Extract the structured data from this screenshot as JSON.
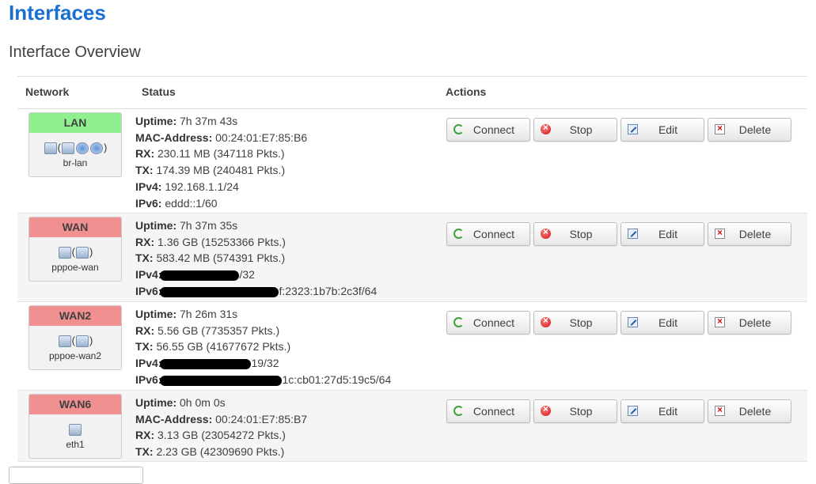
{
  "page": {
    "title": "Interfaces",
    "section": "Interface Overview"
  },
  "table": {
    "headers": {
      "network": "Network",
      "status": "Status",
      "actions": "Actions"
    },
    "actions": {
      "connect": "Connect",
      "stop": "Stop",
      "edit": "Edit",
      "delete": "Delete"
    },
    "rows": [
      {
        "name": "LAN",
        "color": "#90f090",
        "device": "br-lan",
        "icons": [
          "ethernet-icon",
          "bridge-icon",
          "wifi-icon",
          "wifi-icon"
        ],
        "status": [
          {
            "k": "Uptime:",
            "v": " 7h 37m 43s"
          },
          {
            "k": "MAC-Address:",
            "v": " 00:24:01:E7:85:B6"
          },
          {
            "k": "RX:",
            "v": " 230.11 MB (347118 Pkts.)"
          },
          {
            "k": "TX:",
            "v": " 174.39 MB (240481 Pkts.)"
          },
          {
            "k": "IPv4:",
            "v": " 192.168.1.1/24"
          },
          {
            "k": "IPv6:",
            "v": " eddd::1/60"
          }
        ]
      },
      {
        "name": "WAN",
        "color": "#f09090",
        "device": "pppoe-wan",
        "icons": [
          "network-icon",
          "ethernet-icon"
        ],
        "status": [
          {
            "k": "Uptime:",
            "v": " 7h 37m 35s"
          },
          {
            "k": "RX:",
            "v": " 1.36 GB (15253366 Pkts.)"
          },
          {
            "k": "TX:",
            "v": " 583.42 MB (574391 Pkts.)"
          },
          {
            "k": "IPv4:",
            "v": "/32"
          },
          {
            "k": "IPv6:",
            "v": "f:2323:1b7b:2c3f/64"
          }
        ]
      },
      {
        "name": "WAN2",
        "color": "#f09090",
        "device": "pppoe-wan2",
        "icons": [
          "network-icon",
          "ethernet-icon"
        ],
        "status": [
          {
            "k": "Uptime:",
            "v": " 7h 26m 31s"
          },
          {
            "k": "RX:",
            "v": " 5.56 GB (7735357 Pkts.)"
          },
          {
            "k": "TX:",
            "v": " 56.55 GB (41677672 Pkts.)"
          },
          {
            "k": "IPv4:",
            "v": "19/32"
          },
          {
            "k": "IPv6:",
            "v": "1c:cb01:27d5:19c5/64"
          }
        ]
      },
      {
        "name": "WAN6",
        "color": "#f09090",
        "device": "eth1",
        "icons": [
          "ethernet-icon"
        ],
        "status": [
          {
            "k": "Uptime:",
            "v": " 0h 0m 0s"
          },
          {
            "k": "MAC-Address:",
            "v": " 00:24:01:E7:85:B7"
          },
          {
            "k": "RX:",
            "v": " 3.13 GB (23054272 Pkts.)"
          },
          {
            "k": "TX:",
            "v": " 2.23 GB (42309690 Pkts.)"
          }
        ]
      }
    ]
  }
}
